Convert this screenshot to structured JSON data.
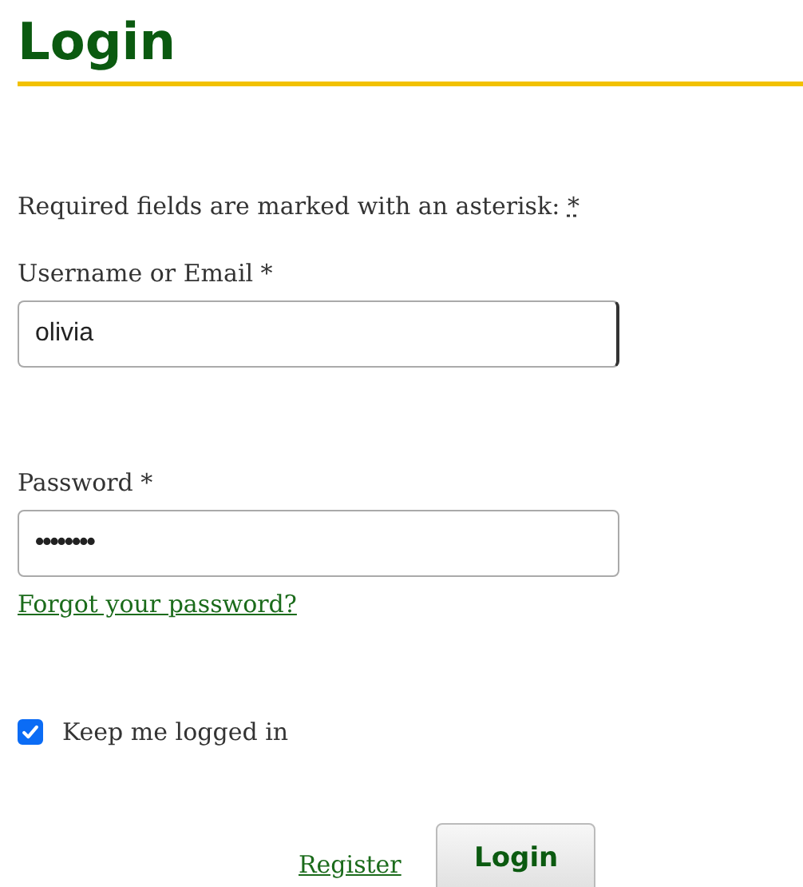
{
  "heading": "Login",
  "required_note": {
    "text": "Required fields are marked with an asterisk:",
    "marker": "*"
  },
  "fields": [
    {
      "label": "Username or Email *",
      "value": "olivia"
    },
    {
      "label": "Password *",
      "value": "••••••••"
    }
  ],
  "forgot_link": "Forgot your password?",
  "remember": {
    "label": "Keep me logged in",
    "checked": true
  },
  "register_link": "Register",
  "submit": "Login"
}
